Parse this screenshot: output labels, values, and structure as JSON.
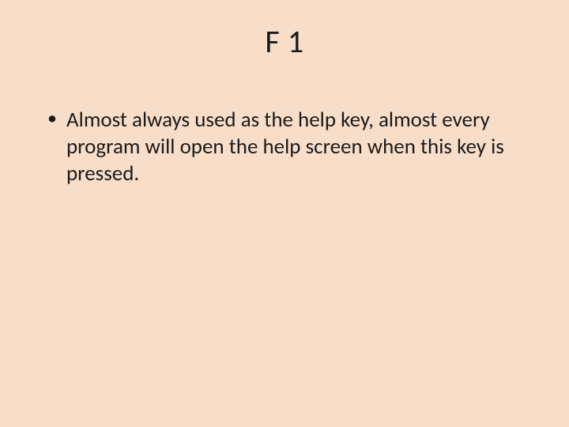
{
  "slide": {
    "title": "F 1",
    "bullets": [
      "Almost always used as the help key, almost every program will open the help screen when this key is pressed."
    ]
  }
}
